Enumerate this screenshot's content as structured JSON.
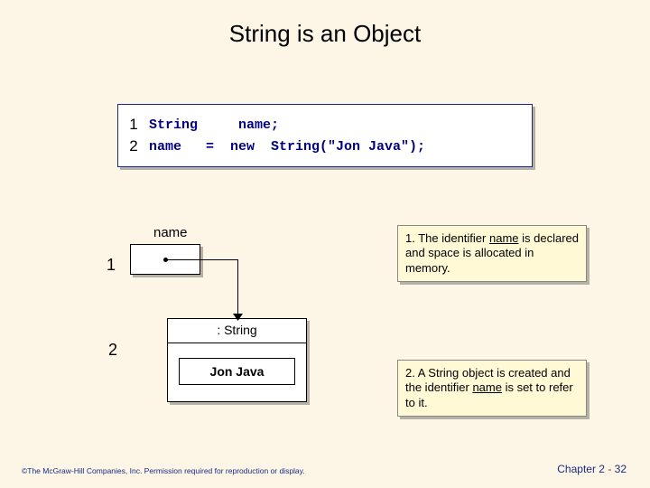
{
  "title": "String is an Object",
  "code": {
    "line1_num": "1",
    "line1_text": "String     name;",
    "line2_num": "2",
    "line2_text": "name   =  new  String(\"Jon Java\");"
  },
  "diagram": {
    "num1": "1",
    "num2": "2",
    "name_label": "name",
    "object_header": ": String",
    "object_value": "Jon Java"
  },
  "callout1": {
    "prefix": "1. The identifier ",
    "underlined": "name",
    "suffix": " is declared and space is allocated in memory."
  },
  "callout2": {
    "prefix": "2. A String object is created and the identifier ",
    "underlined": "name",
    "suffix": " is set to refer to it."
  },
  "footer": {
    "copyright": "©The McGraw-Hill Companies, Inc. Permission required for reproduction or display.",
    "chapter_prefix": "Chapter 2 ",
    "chapter_dash": "-",
    "chapter_page": " 32"
  }
}
